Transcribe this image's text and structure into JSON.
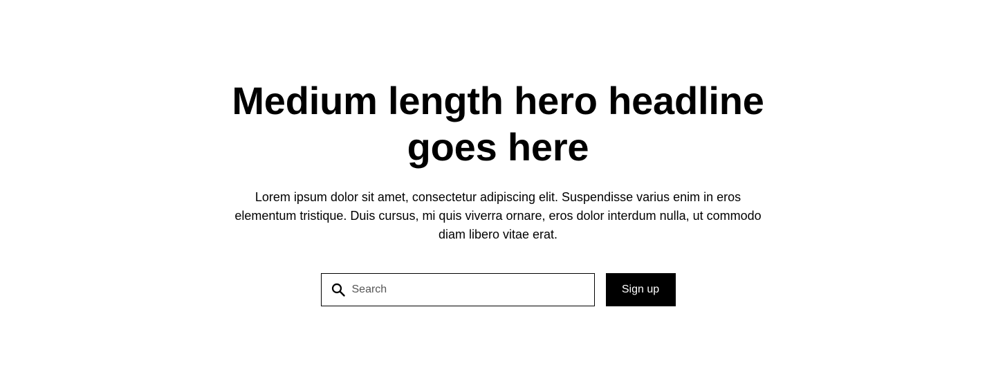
{
  "hero": {
    "headline": "Medium length hero headline goes here",
    "subtext": "Lorem ipsum dolor sit amet, consectetur adipiscing elit. Suspendisse varius enim in eros elementum tristique. Duis cursus, mi quis viverra ornare, eros dolor interdum nulla, ut commodo diam libero vitae erat."
  },
  "form": {
    "search_icon": "search-icon",
    "search_placeholder": "Search",
    "search_value": "",
    "signup_label": "Sign up"
  },
  "colors": {
    "background": "#ffffff",
    "text": "#000000",
    "button_bg": "#000000",
    "button_text": "#ffffff"
  }
}
